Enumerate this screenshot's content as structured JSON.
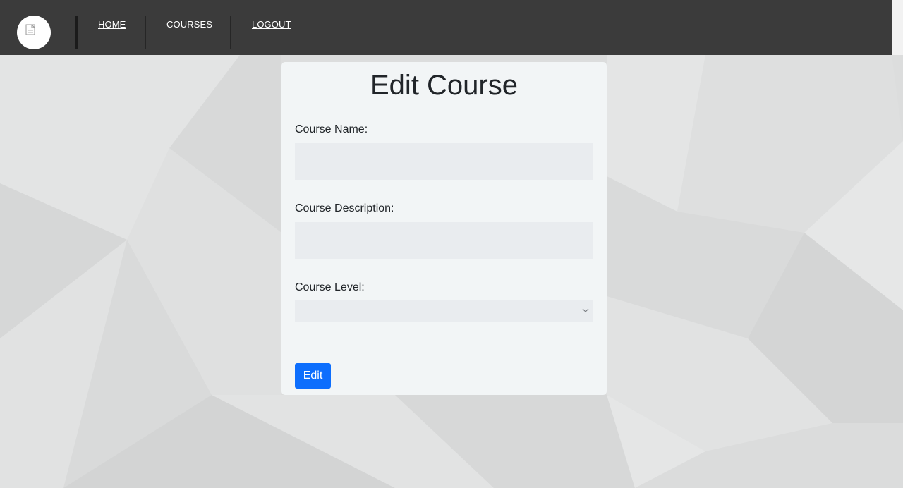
{
  "nav": {
    "logo_icon": "broken-image-icon",
    "links": [
      {
        "label": "HOME"
      },
      {
        "label": "COURSES"
      },
      {
        "label": "LOGOUT"
      }
    ]
  },
  "form": {
    "title": "Edit Course",
    "course_name": {
      "label": "Course Name:",
      "value": ""
    },
    "course_description": {
      "label": "Course Description:",
      "value": ""
    },
    "course_level": {
      "label": "Course Level:",
      "selected": ""
    },
    "submit_label": "Edit"
  },
  "colors": {
    "navbar": "#3b3b3b",
    "card": "#f2f5f6",
    "input": "#e9ecef",
    "primary_button": "#0d6efd",
    "page_background": "#dcdddd"
  }
}
